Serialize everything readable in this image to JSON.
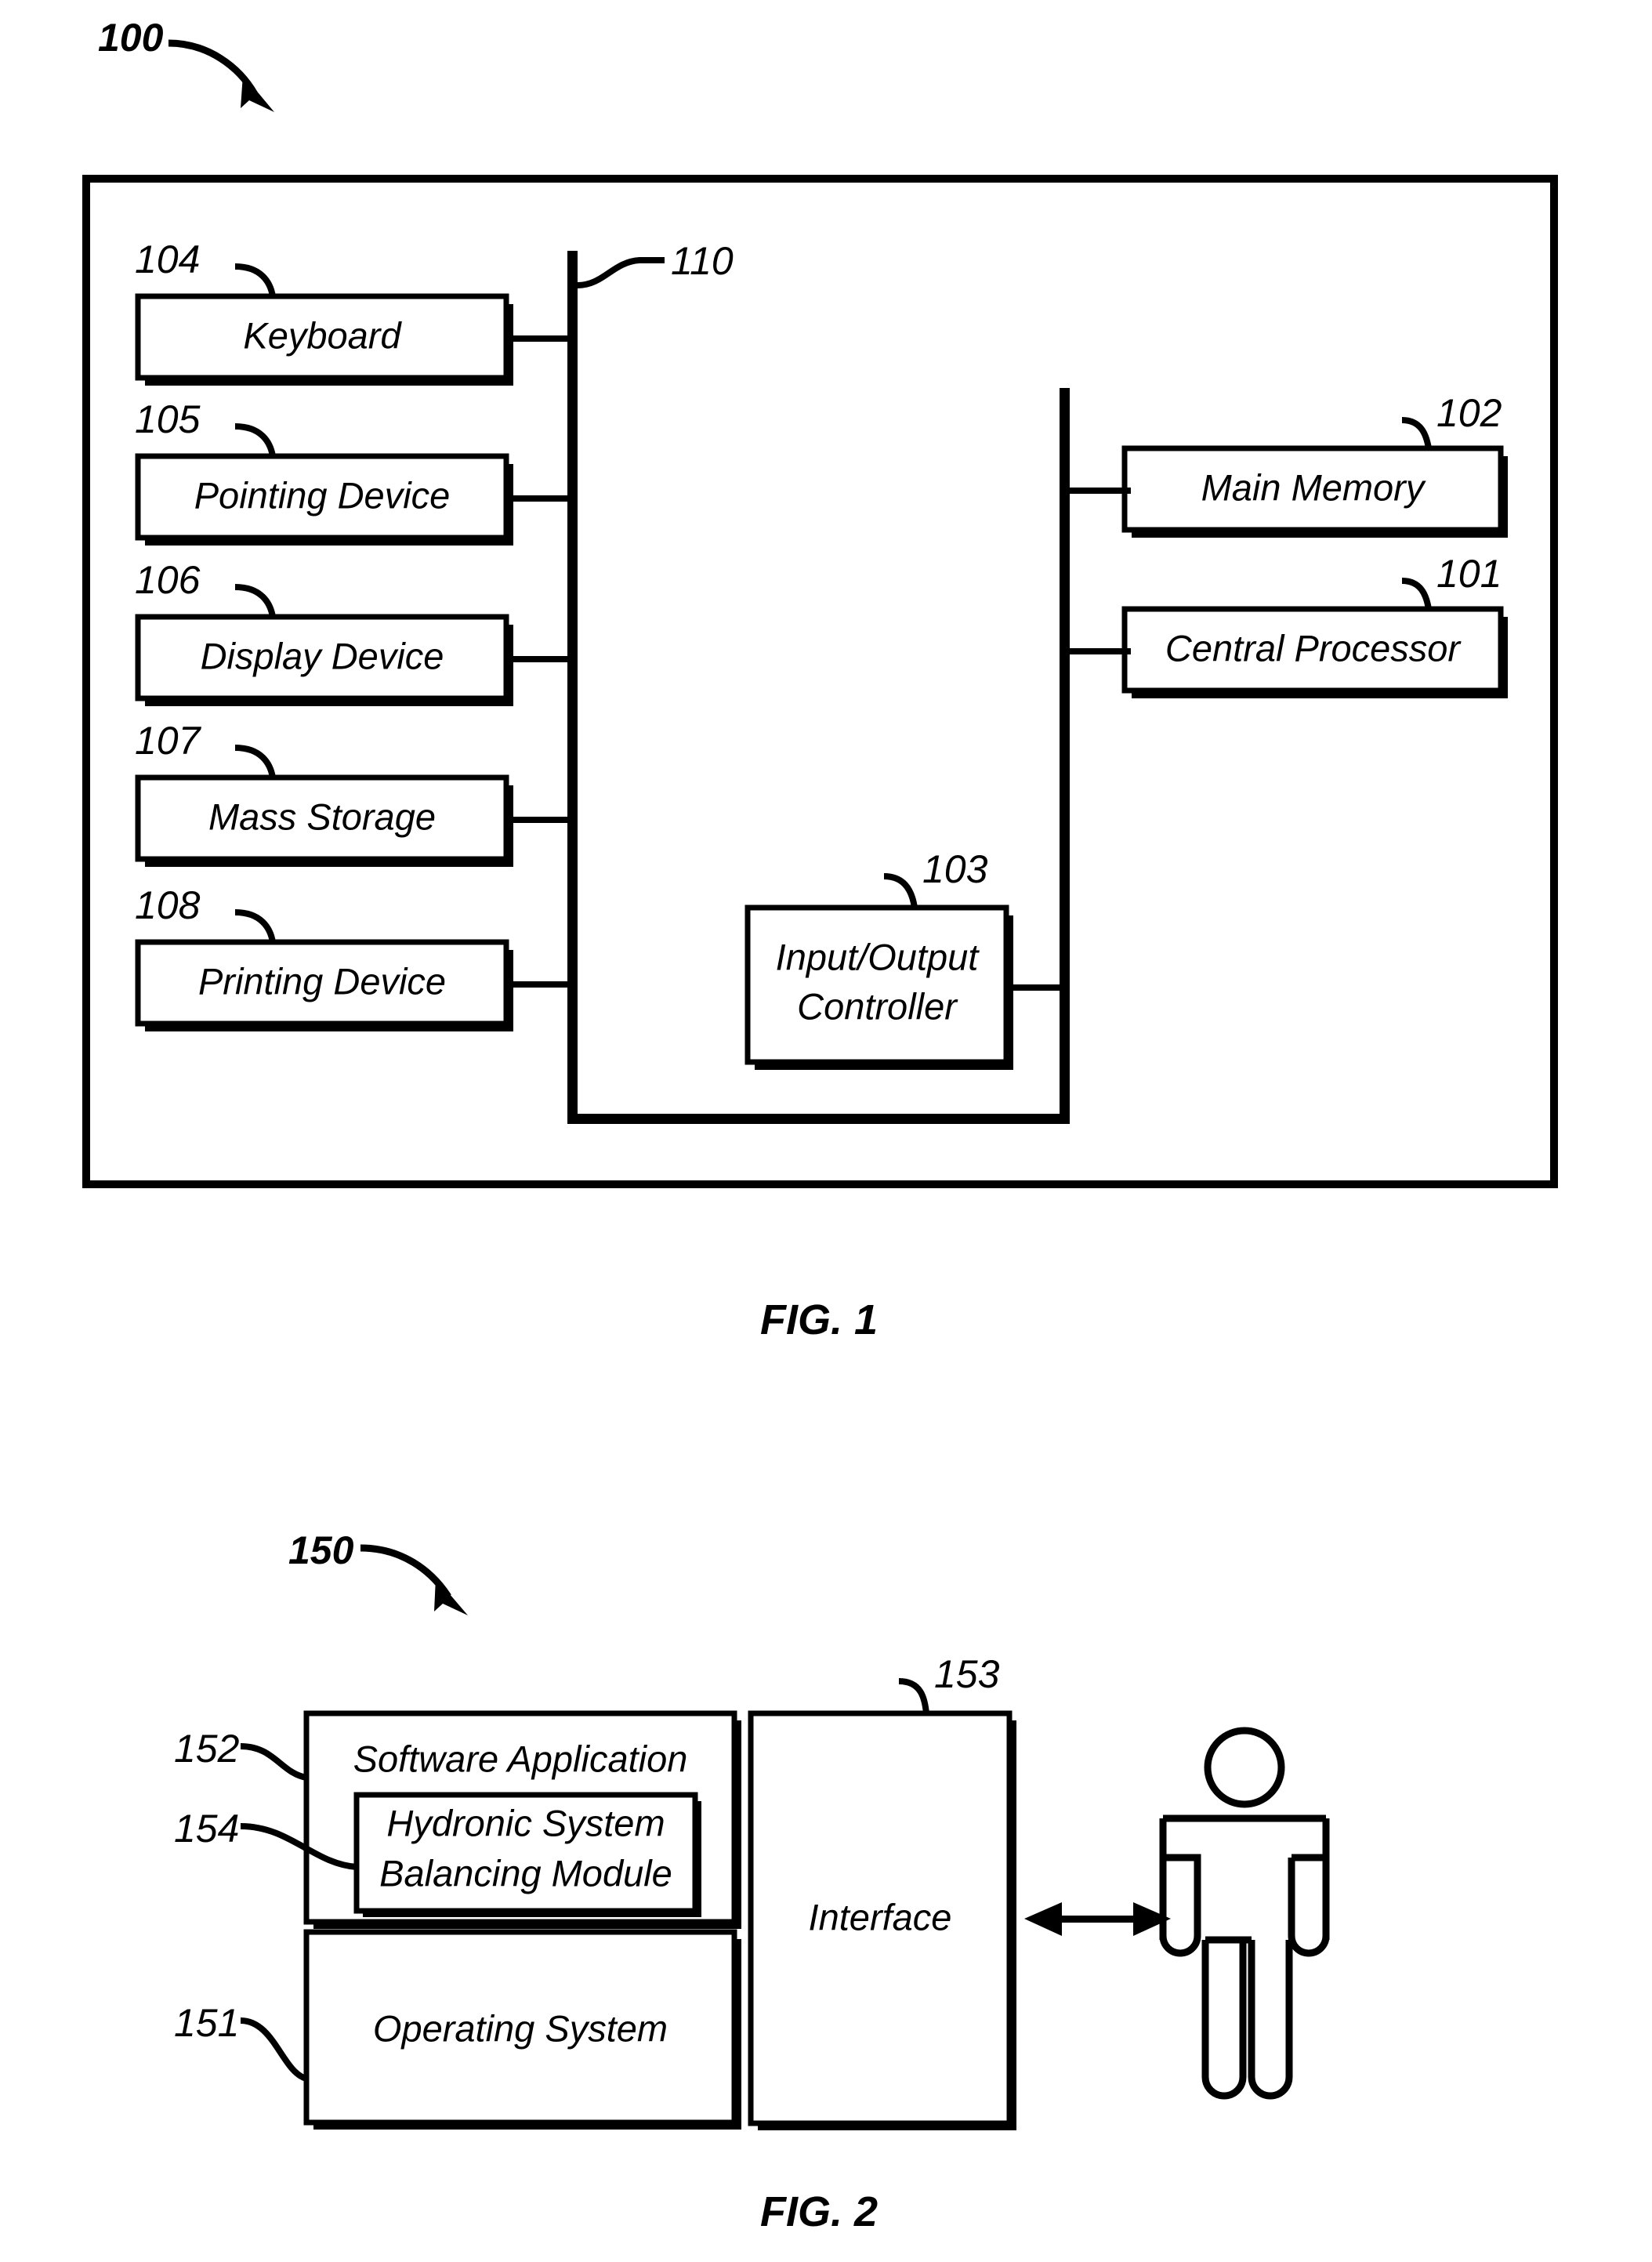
{
  "figure1": {
    "ref": "100",
    "caption": "FIG. 1",
    "bus_ref": "110",
    "left_blocks": [
      {
        "ref": "104",
        "label": "Keyboard"
      },
      {
        "ref": "105",
        "label": "Pointing Device"
      },
      {
        "ref": "106",
        "label": "Display Device"
      },
      {
        "ref": "107",
        "label": "Mass Storage"
      },
      {
        "ref": "108",
        "label": "Printing Device"
      }
    ],
    "right_blocks": [
      {
        "ref": "102",
        "label": "Main Memory"
      },
      {
        "ref": "101",
        "label": "Central Processor"
      }
    ],
    "center_block": {
      "ref": "103",
      "label_line1": "Input/Output",
      "label_line2": "Controller"
    }
  },
  "figure2": {
    "ref": "150",
    "caption": "FIG. 2",
    "blocks": [
      {
        "ref": "152",
        "label": "Software Application"
      },
      {
        "ref": "154",
        "label_line1": "Hydronic System",
        "label_line2": "Balancing Module"
      },
      {
        "ref": "151",
        "label": "Operating System"
      },
      {
        "ref": "153",
        "label": "Interface"
      }
    ],
    "user_icon": "person-icon",
    "link_icon": "double-arrow-icon"
  },
  "colors": {
    "ink": "#000000",
    "paper": "#ffffff"
  }
}
